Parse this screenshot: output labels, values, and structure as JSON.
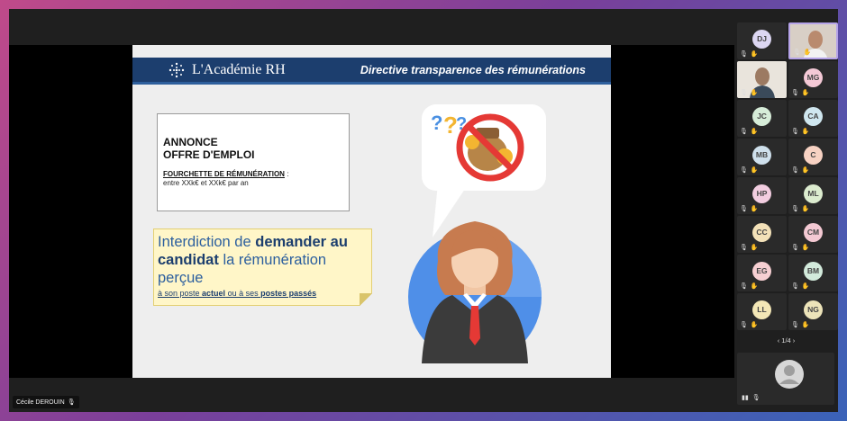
{
  "slide": {
    "brand_name": "L'Académie RH",
    "header_title": "Directive transparence des rémunérations",
    "ad": {
      "title_line1": "ANNONCE",
      "title_line2": "OFFRE D'EMPLOI",
      "salary_label": "FOURCHETTE DE RÉMUNÉRATION",
      "salary_colon": " :",
      "salary_value": "entre XXk€ et XXk€ par an"
    },
    "note": {
      "part1": "Interdiction de ",
      "part2": "demander au candidat",
      "part3": " la rémunération perçue",
      "sub1": "à son poste ",
      "sub2": "actuel",
      "sub3": " ou à ses ",
      "sub4": "postes passés"
    }
  },
  "participants": [
    {
      "initials": "DJ",
      "color": "#dcd6f2"
    },
    {
      "initials": "MG",
      "color": "#f4c9d6"
    },
    {
      "initials": "JC",
      "color": "#d6ecd8"
    },
    {
      "initials": "CA",
      "color": "#cfe6ef"
    },
    {
      "initials": "MB",
      "color": "#cfe0ec"
    },
    {
      "initials": "C",
      "color": "#f7d2c3"
    },
    {
      "initials": "HP",
      "color": "#f2cde0"
    },
    {
      "initials": "ML",
      "color": "#dceccf"
    },
    {
      "initials": "CC",
      "color": "#f3e1b8"
    },
    {
      "initials": "CM",
      "color": "#f4c9d3"
    },
    {
      "initials": "EG",
      "color": "#f6cfd2"
    },
    {
      "initials": "BM",
      "color": "#d2eadb"
    },
    {
      "initials": "LL",
      "color": "#f3e7b6"
    },
    {
      "initials": "NG",
      "color": "#ece3b9"
    }
  ],
  "pager": {
    "label": "1/4"
  },
  "presenter": {
    "name": "Cécile DEROUIN"
  },
  "icons": {
    "mic": "mic-icon",
    "hand": "raise-hand-icon",
    "prev": "chevron-left-icon",
    "next": "chevron-right-icon"
  }
}
